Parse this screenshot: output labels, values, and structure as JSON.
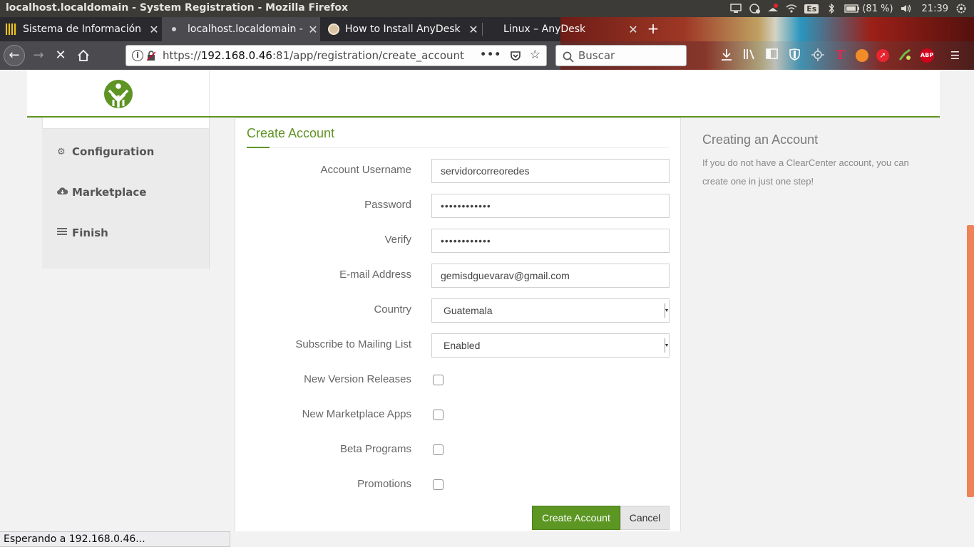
{
  "os": {
    "window_title": "localhost.localdomain - System Registration - Mozilla Firefox",
    "lang": "Es",
    "battery": "(81 %)",
    "clock": "21:39"
  },
  "tabs": [
    {
      "label": "Sistema de Información",
      "active": false
    },
    {
      "label": "localhost.localdomain -",
      "active": true
    },
    {
      "label": "How to Install AnyDesk",
      "active": false
    },
    {
      "label": "Linux – AnyDesk",
      "active": false
    }
  ],
  "urlbar": {
    "prefix": "https://",
    "host": "192.168.0.46",
    "rest": ":81/app/registration/create_account"
  },
  "search": {
    "placeholder": "Buscar"
  },
  "toolbar": {
    "abp_label": "ABP",
    "rd_label": "T"
  },
  "sidebar": {
    "items": [
      {
        "label": "Configuration",
        "icon": "gears-icon"
      },
      {
        "label": "Marketplace",
        "icon": "cloud-download-icon"
      },
      {
        "label": "Finish",
        "icon": "list-icon"
      }
    ]
  },
  "form": {
    "title": "Create Account",
    "username": {
      "label": "Account Username",
      "value": "servidorcorreoredes"
    },
    "password": {
      "label": "Password",
      "value": "••••••••••••"
    },
    "verify": {
      "label": "Verify",
      "value": "••••••••••••"
    },
    "email": {
      "label": "E-mail Address",
      "value": "gemisdguevarav@gmail.com"
    },
    "country": {
      "label": "Country",
      "value": "Guatemala"
    },
    "mailing": {
      "label": "Subscribe to Mailing List",
      "value": "Enabled"
    },
    "checks": [
      {
        "label": "New Version Releases",
        "checked": false
      },
      {
        "label": "New Marketplace Apps",
        "checked": false
      },
      {
        "label": "Beta Programs",
        "checked": false
      },
      {
        "label": "Promotions",
        "checked": false
      }
    ],
    "create_label": "Create Account",
    "cancel_label": "Cancel"
  },
  "help": {
    "title": "Creating an Account",
    "text": "If you do not have a ClearCenter account, you can create one in just one step!"
  },
  "status": "Esperando a 192.168.0.46...",
  "colors": {
    "accent": "#5f9425",
    "scroll": "#f0825a"
  }
}
